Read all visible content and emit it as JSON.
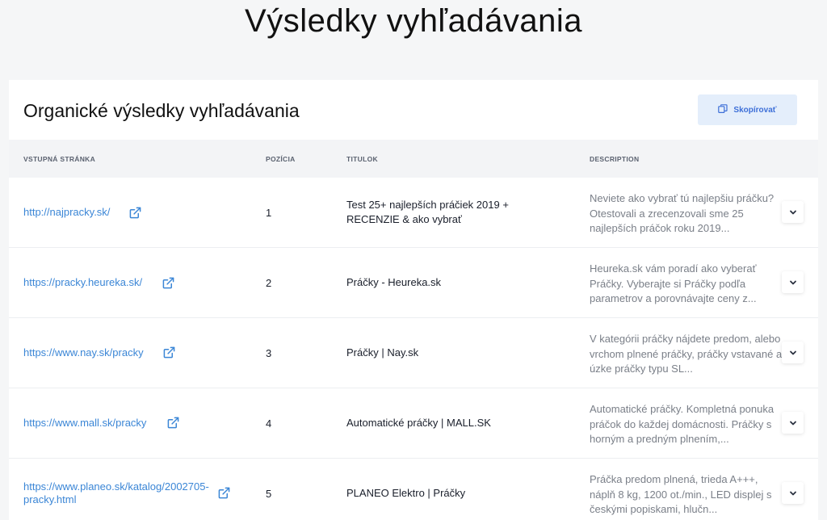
{
  "page": {
    "title": "Výsledky vyhľadávania"
  },
  "card": {
    "title": "Organické výsledky vyhľadávania",
    "copy_label": "Skopírovať",
    "copy_icon": "copy-icon"
  },
  "table": {
    "headers": {
      "page": "VSTUPNÁ STRÁNKA",
      "position": "POZÍCIA",
      "title": "TITULOK",
      "description": "DESCRIPTION"
    },
    "rows": [
      {
        "url": "http://najpracky.sk/",
        "position": "1",
        "title": "Test 25+ najlepších práčiek 2019 + RECENZIE & ako vybrať",
        "description": "Neviete ako vybrať tú najlepšiu práčku? Otestovali a zrecenzovali sme 25 najlepších práčok roku 2019..."
      },
      {
        "url": "https://pracky.heureka.sk/",
        "position": "2",
        "title": "Práčky - Heureka.sk",
        "description": "Heureka.sk vám poradí ako vyberať Práčky. Vyberajte si Práčky podľa parametrov a porovnávajte ceny z..."
      },
      {
        "url": "https://www.nay.sk/pracky",
        "position": "3",
        "title": "Práčky | Nay.sk",
        "description": "V kategórii práčky nájdete predom, alebo vrchom plnené práčky, práčky vstavané a úzke práčky typu SL..."
      },
      {
        "url": "https://www.mall.sk/pracky",
        "position": "4",
        "title": "Automatické práčky | MALL.SK",
        "description": "Automatické práčky. Kompletná ponuka práčok do každej domácnosti. Práčky s horným a predným plnením,..."
      },
      {
        "url": "https://www.planeo.sk/katalog/2002705-pracky.html",
        "position": "5",
        "title": "PLANEO Elektro | Práčky",
        "description": "Práčka predom plnená, trieda A+++, náplň 8 kg, 1200 ot./min., LED displej s českými popiskami, hlučn..."
      }
    ]
  },
  "colors": {
    "link": "#3b86d6",
    "copy_bg": "#e4eefb",
    "copy_text": "#3d6fd8",
    "header_bg": "#f3f4f6"
  },
  "icons": {
    "external_link": "external-link-icon",
    "expand": "chevron-down-icon"
  }
}
